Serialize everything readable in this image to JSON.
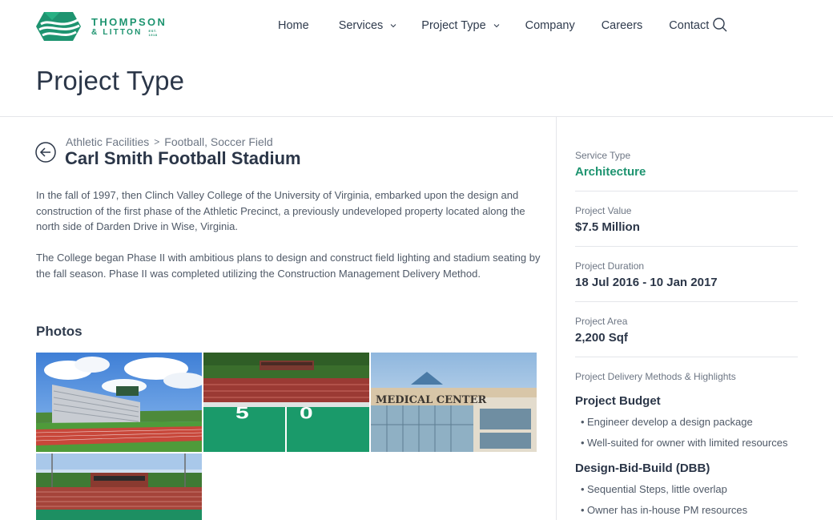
{
  "brand": {
    "line1": "THOMPSON",
    "line2": "& LITTON",
    "est": "EST. 1918",
    "accent_color": "#1e9470",
    "text_color": "#2b3648"
  },
  "nav": {
    "items": [
      {
        "label": "Home",
        "has_dropdown": false
      },
      {
        "label": "Services",
        "has_dropdown": true
      },
      {
        "label": "Project Type",
        "has_dropdown": true
      },
      {
        "label": "Company",
        "has_dropdown": false
      },
      {
        "label": "Careers",
        "has_dropdown": false
      },
      {
        "label": "Contact",
        "has_dropdown": false
      }
    ],
    "search_icon": "search-icon"
  },
  "page": {
    "title": "Project Type"
  },
  "project": {
    "breadcrumb": [
      "Athletic Facilities",
      "Football, Soccer Field"
    ],
    "breadcrumb_separator": ">",
    "title": "Carl Smith Football Stadium",
    "paragraphs": [
      "In the fall of 1997, then Clinch Valley College of the University of Virginia, embarked upon the design and construction of the first phase of the Athletic Precinct, a previously undeveloped property located along the north side of Darden Drive in Wise, Virginia.",
      "The College began Phase II with ambitious plans to design and construct field lighting and stadium seating by the fall season. Phase II was completed utilizing the Construction Management Delivery Method."
    ],
    "photos_heading": "Photos",
    "photos": [
      {
        "subject": "stadium-bleachers-track"
      },
      {
        "subject": "football-field-50-yard-line"
      },
      {
        "subject": "medical-center-building",
        "sign_text": "MEDICAL CENTER"
      },
      {
        "subject": "stadium-press-box-seating"
      }
    ]
  },
  "sidebar": {
    "service_type": {
      "label": "Service Type",
      "value": "Architecture"
    },
    "project_value": {
      "label": "Project Value",
      "value": "$7.5 Million"
    },
    "project_duration": {
      "label": "Project Duration",
      "value": "18 Jul 2016 - 10 Jan 2017"
    },
    "project_area": {
      "label": "Project Area",
      "value": "2,200 Sqf"
    },
    "highlights": {
      "label": "Project Delivery Methods & Highlights",
      "groups": [
        {
          "title": "Project Budget",
          "bullet": "•",
          "items": [
            "Engineer develop a design package",
            "Well-suited for owner with limited resources"
          ]
        },
        {
          "title": "Design-Bid-Build (DBB)",
          "bullet": "•",
          "items": [
            "Sequential Steps, little overlap",
            "Owner has in-house PM resources"
          ]
        }
      ]
    }
  }
}
